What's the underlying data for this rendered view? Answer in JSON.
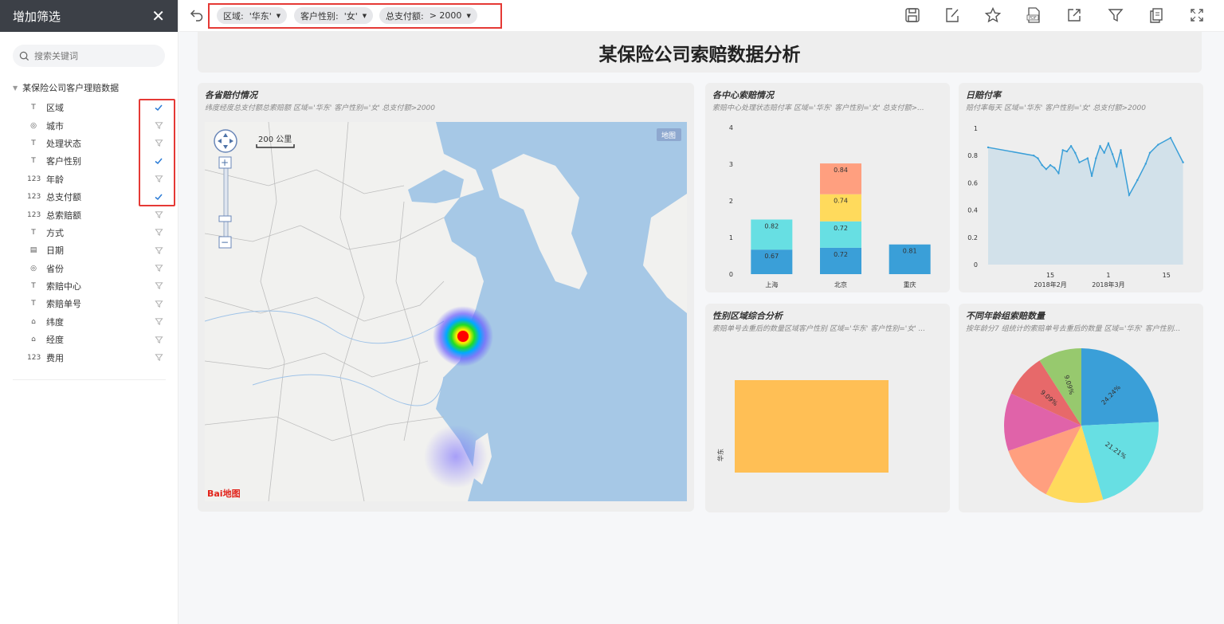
{
  "sidebar": {
    "title": "增加筛选",
    "search_placeholder": "搜索关键词",
    "root_label": "某保险公司客户理赔数据",
    "fields": [
      {
        "label": "区域",
        "type": "text",
        "checked": true
      },
      {
        "label": "城市",
        "type": "geo",
        "checked": false
      },
      {
        "label": "处理状态",
        "type": "text",
        "checked": false
      },
      {
        "label": "客户性别",
        "type": "text",
        "checked": true
      },
      {
        "label": "年龄",
        "type": "number",
        "checked": false
      },
      {
        "label": "总支付额",
        "type": "number",
        "checked": true
      },
      {
        "label": "总索赔额",
        "type": "number",
        "checked": false
      },
      {
        "label": "方式",
        "type": "text",
        "checked": false
      },
      {
        "label": "日期",
        "type": "date",
        "checked": false
      },
      {
        "label": "省份",
        "type": "geo",
        "checked": false
      },
      {
        "label": "索赔中心",
        "type": "text",
        "checked": false
      },
      {
        "label": "索赔单号",
        "type": "text",
        "checked": false
      },
      {
        "label": "纬度",
        "type": "latlng",
        "checked": false
      },
      {
        "label": "经度",
        "type": "latlng",
        "checked": false
      },
      {
        "label": "费用",
        "type": "number",
        "checked": false
      }
    ]
  },
  "toolbar": {
    "filters": [
      {
        "label": "区域:",
        "value": "'华东'"
      },
      {
        "label": "客户性别:",
        "value": "'女'"
      },
      {
        "label": "总支付额:",
        "value": "> 2000"
      }
    ]
  },
  "dashboard": {
    "title": "某保险公司索赔数据分析",
    "map_panel": {
      "title": "各省赔付情况",
      "subtitle": "纬度经度总支付额总索赔额 区域='华东' 客户性别='女' 总支付额>2000",
      "scale_label": "200 公里",
      "map_button": "地图",
      "logo_text": "Bai地图"
    },
    "center_panel": {
      "title": "各中心索赔情况",
      "subtitle": "索赔中心处理状态赔付率 区域='华东' 客户性别='女' 总支付额>..."
    },
    "daily_panel": {
      "title": "日赔付率",
      "subtitle": "赔付率每天 区域='华东' 客户性别='女' 总支付额>2000"
    },
    "gender_panel": {
      "title": "性别区域综合分析",
      "subtitle": "索赔单号去重后的数量区域客户性别 区域='华东' 客户性别='女' ..."
    },
    "age_panel": {
      "title": "不同年龄组索赔数量",
      "subtitle": "按年龄分7 组统计的索赔单号去重后的数量 区域='华东' 客户性别..."
    }
  },
  "colors": {
    "blue": "#3a9fd8",
    "cyan": "#67dfe3",
    "yellow": "#ffda5c",
    "salmon": "#ff9f7f",
    "green": "#97c96e",
    "red": "#e7696a",
    "pink": "#e063a9",
    "orange": "#ffbf55"
  },
  "chart_data": [
    {
      "id": "center",
      "type": "bar",
      "stacked": true,
      "categories": [
        "上海",
        "北京",
        "重庆"
      ],
      "ylim": [
        0,
        4
      ],
      "yticks": [
        0,
        1,
        2,
        3,
        4
      ],
      "stacks": [
        [
          {
            "value": 0.67,
            "color": "#3a9fd8"
          },
          {
            "value": 0.82,
            "color": "#67dfe3"
          }
        ],
        [
          {
            "value": 0.72,
            "color": "#3a9fd8"
          },
          {
            "value": 0.72,
            "color": "#67dfe3"
          },
          {
            "value": 0.74,
            "color": "#ffda5c"
          },
          {
            "value": 0.84,
            "color": "#ff9f7f"
          }
        ],
        [
          {
            "value": 0.81,
            "color": "#3a9fd8"
          }
        ]
      ]
    },
    {
      "id": "daily",
      "type": "area",
      "ylim": [
        0,
        1
      ],
      "yticks": [
        "0",
        "0.2",
        "0.4",
        "0.6",
        "0.8",
        "1"
      ],
      "x_ticks": [
        {
          "label": "15",
          "sub": "2018年2月",
          "t": 24
        },
        {
          "label": "1",
          "sub": "2018年3月",
          "t": 38
        },
        {
          "label": "15",
          "sub": "",
          "t": 52
        }
      ],
      "x_range": [
        9,
        58
      ],
      "points": [
        [
          9,
          0.86
        ],
        [
          20,
          0.8
        ],
        [
          21,
          0.78
        ],
        [
          22,
          0.73
        ],
        [
          23,
          0.7
        ],
        [
          24,
          0.73
        ],
        [
          25,
          0.71
        ],
        [
          26,
          0.67
        ],
        [
          27,
          0.84
        ],
        [
          28,
          0.83
        ],
        [
          29,
          0.87
        ],
        [
          30,
          0.82
        ],
        [
          31,
          0.75
        ],
        [
          33,
          0.78
        ],
        [
          34,
          0.65
        ],
        [
          35,
          0.78
        ],
        [
          36,
          0.87
        ],
        [
          37,
          0.82
        ],
        [
          38,
          0.89
        ],
        [
          39,
          0.81
        ],
        [
          40,
          0.72
        ],
        [
          41,
          0.84
        ],
        [
          43,
          0.51
        ],
        [
          45,
          0.62
        ],
        [
          47,
          0.74
        ],
        [
          48,
          0.82
        ],
        [
          50,
          0.88
        ],
        [
          53,
          0.93
        ],
        [
          56,
          0.75
        ]
      ]
    },
    {
      "id": "gender",
      "type": "bar",
      "orientation": "horizontal",
      "categories": [
        "华东"
      ],
      "values": [
        1
      ],
      "color": "#ffbf55"
    },
    {
      "id": "age",
      "type": "pie",
      "slices": [
        {
          "value": 24.24,
          "label": "24.24%",
          "color": "#3a9fd8"
        },
        {
          "value": 21.21,
          "label": "21.21%",
          "color": "#67dfe3"
        },
        {
          "value": 12.12,
          "label": "",
          "color": "#ffda5c"
        },
        {
          "value": 12.12,
          "label": "",
          "color": "#ff9f7f"
        },
        {
          "value": 12.12,
          "label": "",
          "color": "#e063a9"
        },
        {
          "value": 9.09,
          "label": "9.09%",
          "color": "#e7696a"
        },
        {
          "value": 9.09,
          "label": "9.09%",
          "color": "#97c96e"
        }
      ]
    }
  ]
}
